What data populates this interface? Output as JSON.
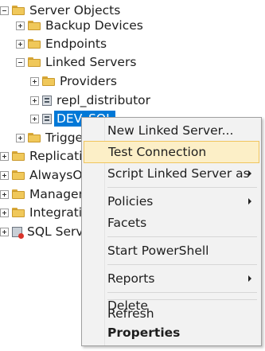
{
  "tree": {
    "server_objects": "Server Objects",
    "backup_devices": "Backup Devices",
    "endpoints": "Endpoints",
    "linked_servers": "Linked Servers",
    "providers": "Providers",
    "repl_distributor": "repl_distributor",
    "dev_sql": "DEV_SQL",
    "triggers": "Triggers",
    "replication": "Replication",
    "alwayson": "AlwaysOn High Availability",
    "management": "Management",
    "integration": "Integration Services Catalogs",
    "sql_server_agent": "SQL Server Agent"
  },
  "context_menu": {
    "new_linked_server": "New Linked Server...",
    "test_connection": "Test Connection",
    "script_linked_server_as": "Script Linked Server as",
    "policies": "Policies",
    "facets": "Facets",
    "start_powershell": "Start PowerShell",
    "reports": "Reports",
    "delete": "Delete",
    "refresh": "Refresh",
    "properties": "Properties"
  },
  "colors": {
    "selection": "#0078d7",
    "menu_hover": "#fcefc7",
    "menu_hover_border": "#f0c55e",
    "folder": "#f0c85a"
  }
}
